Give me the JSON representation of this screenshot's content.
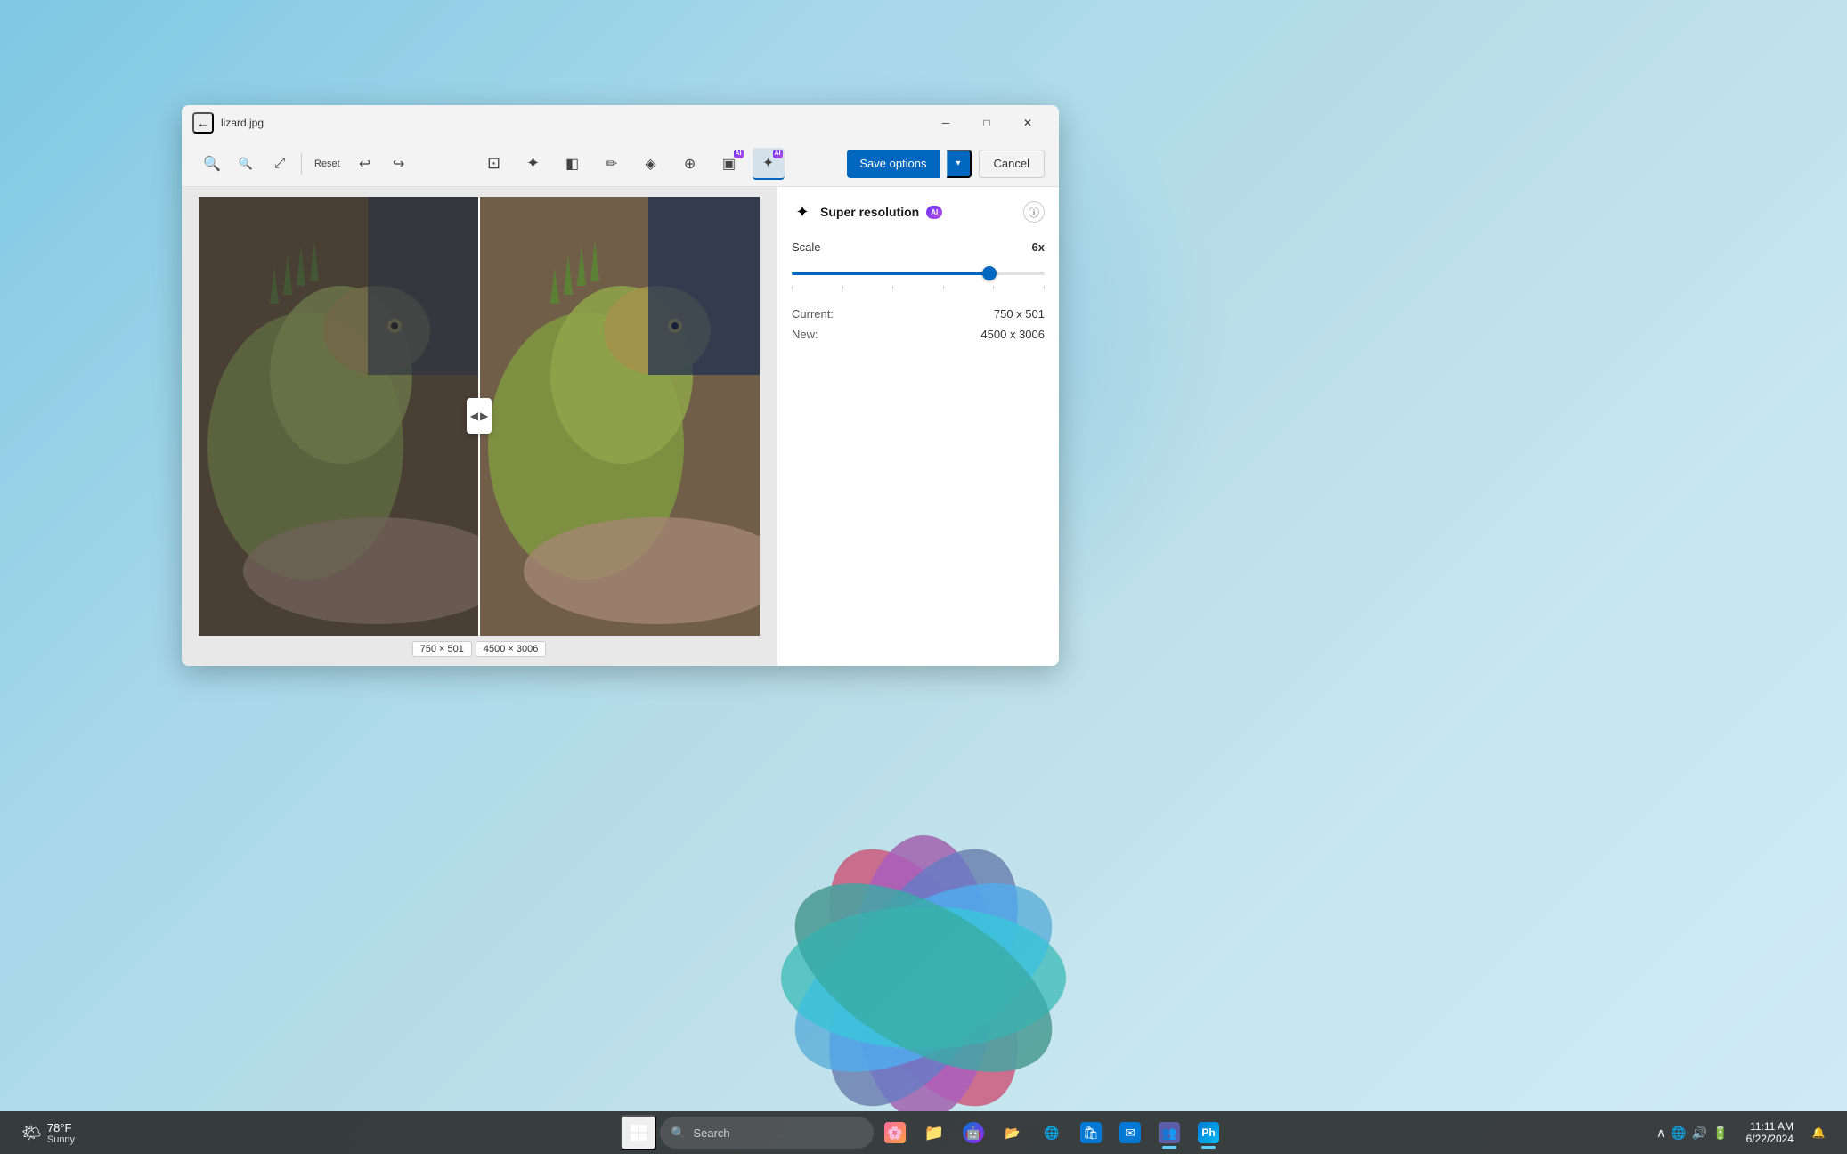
{
  "window": {
    "title": "lizard.jpg",
    "back_label": "←"
  },
  "toolbar": {
    "reset_label": "Reset",
    "save_options_label": "Save options",
    "cancel_label": "Cancel"
  },
  "panel": {
    "title": "Super resolution",
    "ai_label": "AI",
    "scale_label": "Scale",
    "scale_value": "6x",
    "current_label": "Current:",
    "current_value": "750 x 501",
    "new_label": "New:",
    "new_value": "4500 x 3006",
    "slider_percent": 78
  },
  "image": {
    "left_label": "750 × 501",
    "right_label": "4500 × 3006"
  },
  "taskbar": {
    "weather_temp": "78°F",
    "weather_condition": "Sunny",
    "search_placeholder": "Search",
    "clock_time": "11:11 AM",
    "clock_date": "6/22/2024"
  }
}
